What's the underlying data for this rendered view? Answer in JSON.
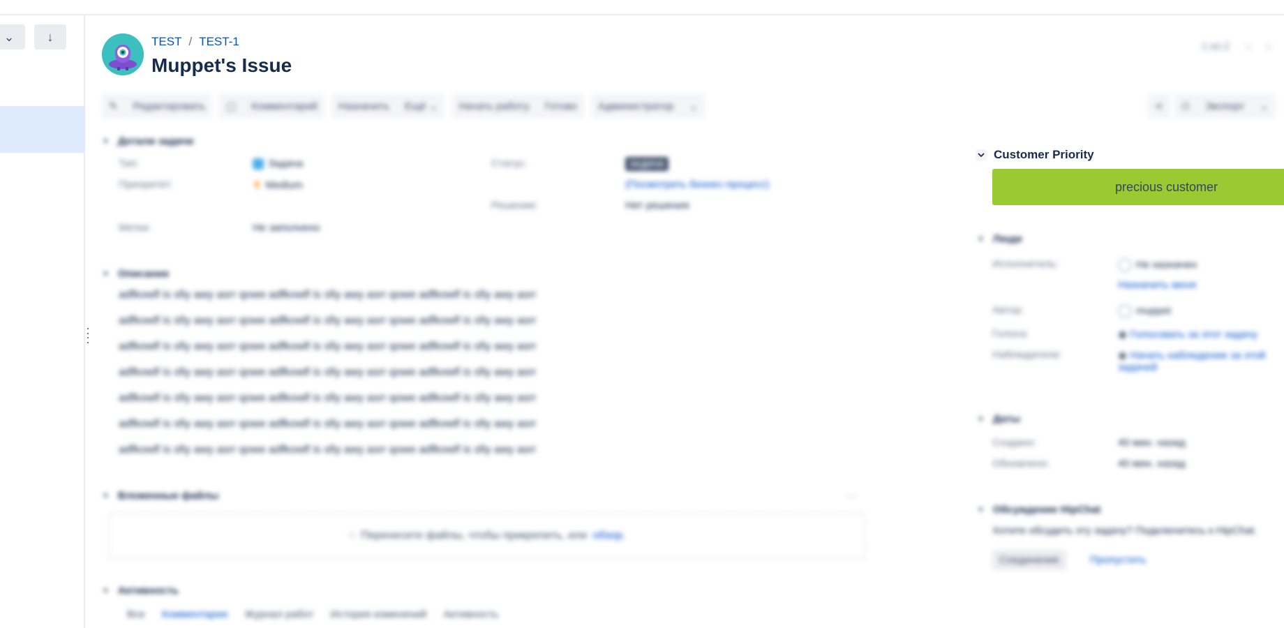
{
  "left_panel": {
    "btn1_icon": "⌄",
    "btn2_icon": "↓"
  },
  "header": {
    "project_key": "TEST",
    "separator": "/",
    "issue_key": "TEST-1",
    "title": "Muppet's Issue",
    "pager_text": "1 из 2"
  },
  "toolbar": {
    "edit": "Редактировать",
    "comment": "Комментарий",
    "assign": "Назначить",
    "more": "Ещё",
    "start_work": "Начать работу",
    "done": "Готово",
    "admin": "Администратор",
    "export": "Экспорт"
  },
  "details": {
    "heading": "Детали задачи",
    "type_label": "Тип:",
    "type_value": "Задача",
    "priority_label": "Приоритет:",
    "priority_value": "Medium",
    "labels_label": "Метки:",
    "labels_value": "Не заполнено",
    "status_label": "Статус:",
    "status_value": "ЗАДАЧА",
    "workflow_link": "(Посмотреть бизнес-процесс)",
    "resolution_label": "Решение:",
    "resolution_value": "Нет решения"
  },
  "description": {
    "heading": "Описание",
    "lines": [
      "adfkowlf is sfiy awy asrr qowe adfkowlf is sfiy awy asrr qowe adfkowlf is sfiy awy asrr",
      "adfkowlf is sfiy awy asrr qowe adfkowlf is sfiy awy asrr qowe adfkowlf is sfiy awy asrr",
      "adfkowlf is sfiy awy asrr qowe adfkowlf is sfiy awy asrr qowe adfkowlf is sfiy awy asrr",
      "adfkowlf is sfiy awy asrr qowe adfkowlf is sfiy awy asrr qowe adfkowlf is sfiy awy asrr",
      "adfkowlf is sfiy awy asrr qowe adfkowlf is sfiy awy asrr qowe adfkowlf is sfiy awy asrr",
      "adfkowlf is sfiy awy asrr qowe adfkowlf is sfiy awy asrr qowe adfkowlf is sfiy awy asrr",
      "adfkowlf is sfiy awy asrr qowe adfkowlf is sfiy awy asrr qowe adfkowlf is sfiy awy asrr"
    ]
  },
  "attachments": {
    "heading": "Вложенные файлы",
    "drop_text": "Перенесите файлы, чтобы прикрепить, или",
    "browse_link": "обзор."
  },
  "activity": {
    "heading": "Активность",
    "tabs": [
      "Все",
      "Комментарии",
      "Журнал работ",
      "История изменений",
      "Активность"
    ]
  },
  "customer_priority": {
    "title": "Customer Priority",
    "value": "precious customer",
    "color": "#99ca31"
  },
  "people": {
    "heading": "Люди",
    "assignee_label": "Исполнитель:",
    "assignee_value": "Не назначен",
    "assign_me": "Назначить меня",
    "reporter_label": "Автор:",
    "reporter_value": "muppet",
    "votes_label": "Голоса:",
    "votes_link": "Голосовать за этот задачу",
    "watchers_label": "Наблюдатели:",
    "watchers_link": "Начать наблюдение за этой задачей"
  },
  "dates": {
    "heading": "Даты",
    "created_label": "Создано:",
    "created_value": "40 мин. назад",
    "updated_label": "Обновлено:",
    "updated_value": "40 мин. назад"
  },
  "hipchat": {
    "heading": "Обсуждение HipChat",
    "prompt": "Хотите обсудить эту задачу? Подключитесь к HipChat.",
    "connect_button": "Соединение",
    "skip_link": "Пропустить"
  }
}
